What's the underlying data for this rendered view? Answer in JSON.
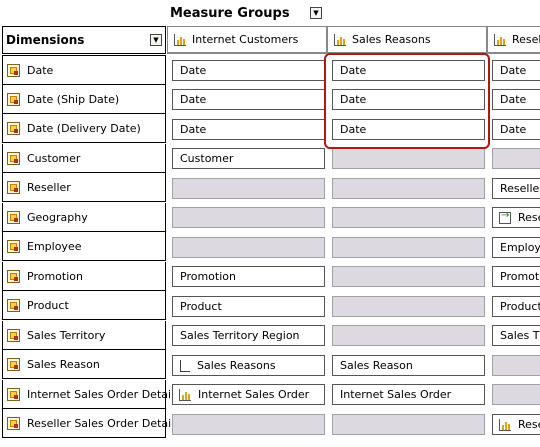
{
  "measure_groups_label": "Measure Groups",
  "dimensions_label": "Dimensions",
  "measure_groups": [
    "Internet Customers",
    "Sales Reasons",
    "Resel"
  ],
  "dimensions": [
    "Date",
    "Date (Ship Date)",
    "Date (Delivery Date)",
    "Customer",
    "Reseller",
    "Geography",
    "Employee",
    "Promotion",
    "Product",
    "Sales Territory",
    "Sales Reason",
    "Internet Sales Order Details",
    "Reseller Sales Order Details"
  ],
  "cells": {
    "internet_customers": [
      "Date",
      "Date",
      "Date",
      "Customer",
      "",
      "",
      "",
      "Promotion",
      "Product",
      "Sales Territory Region",
      "Sales Reasons",
      "Internet Sales Order",
      ""
    ],
    "sales_reasons": [
      "Date",
      "Date",
      "Date",
      "",
      "",
      "",
      "",
      "",
      "",
      "",
      "Sales Reason",
      "Internet Sales Order",
      ""
    ],
    "resel": [
      "Date",
      "Date",
      "Date",
      "",
      "Reseller",
      "Rese",
      "Employe",
      "Promotio",
      "Product",
      "Sales T",
      "",
      "",
      "Rese"
    ]
  },
  "colors": {
    "highlight": "#b01818",
    "empty_cell": "#dcd9e0"
  }
}
